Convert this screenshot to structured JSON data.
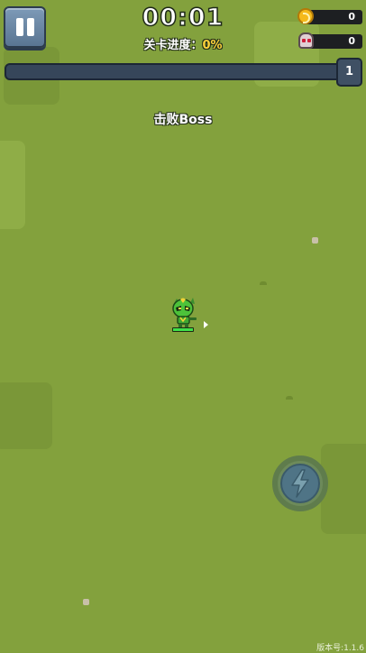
{
  "hud": {
    "timer": "00:01",
    "progress_label": "关卡进度：",
    "progress_value": "0%",
    "gold_count": "0",
    "kill_count": "0",
    "level": "1",
    "xp_fraction": 0
  },
  "objective": "击败Boss",
  "player": {
    "hp_fraction": 1.0
  },
  "icons": {
    "pause": "pause-icon",
    "gold": "coin-icon",
    "kills": "skull-icon",
    "skill": "lightning-icon"
  },
  "colors": {
    "grass": "#83a13d",
    "xp_bar": "#36465a",
    "hp": "#3fe04a",
    "progress_value": "#ffd23a"
  },
  "version": "版本号:1.1.6"
}
